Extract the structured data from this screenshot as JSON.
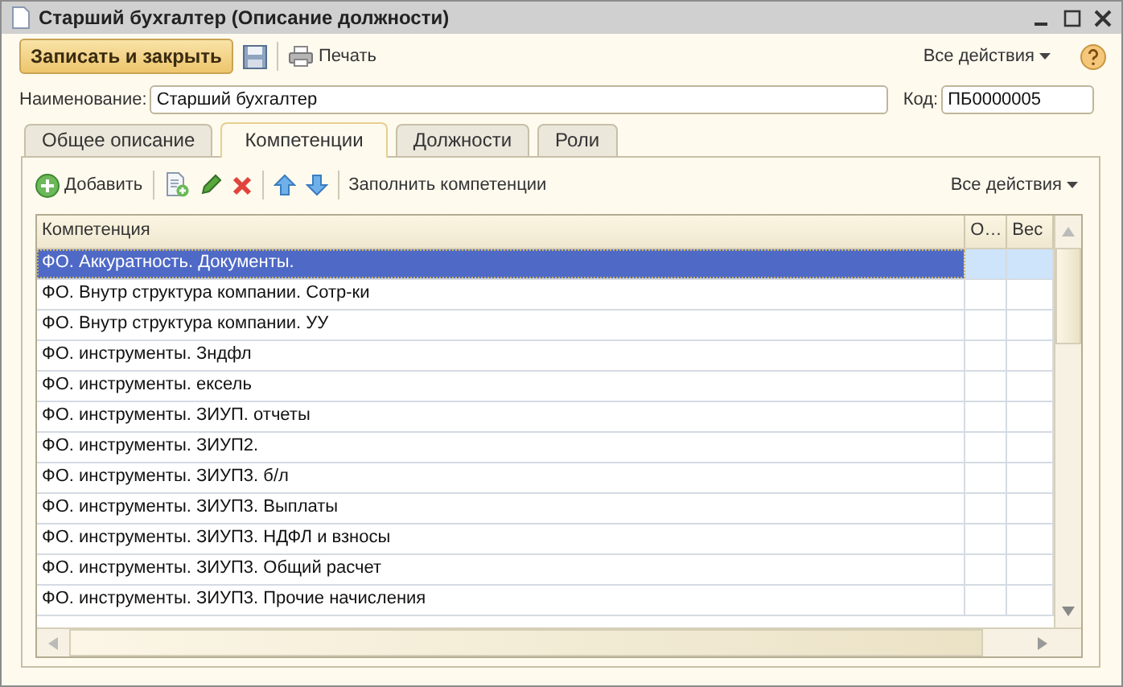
{
  "window": {
    "title": "Старший бухгалтер (Описание должности)"
  },
  "toolbar": {
    "save_close": "Записать и закрыть",
    "print": "Печать",
    "all_actions": "Все действия"
  },
  "fields": [
    {
      "label": "Наименование:",
      "value": "Старший бухгалтер"
    },
    {
      "label": "Код:",
      "value": "ПБ0000005"
    }
  ],
  "tabs": [
    {
      "label": "Общее описание",
      "selected": false
    },
    {
      "label": "Компетенции",
      "selected": true
    },
    {
      "label": "Должности",
      "selected": false
    },
    {
      "label": "Роли",
      "selected": false
    }
  ],
  "panel_toolbar": {
    "add": "Добавить",
    "fill": "Заполнить компетенции",
    "all_actions": "Все действия"
  },
  "table": {
    "columns": [
      "Компетенция",
      "О…",
      "Вес"
    ],
    "rows": [
      {
        "cells": [
          "ФО. Аккуратность. Документы.",
          "",
          ""
        ],
        "selected": true
      },
      {
        "cells": [
          "ФО. Внутр структура компании. Сотр-ки",
          "",
          ""
        ],
        "selected": false
      },
      {
        "cells": [
          "ФО. Внутр структура компании. УУ",
          "",
          ""
        ],
        "selected": false
      },
      {
        "cells": [
          "ФО. инструменты. Зндфл",
          "",
          ""
        ],
        "selected": false
      },
      {
        "cells": [
          "ФО. инструменты. ексель",
          "",
          ""
        ],
        "selected": false
      },
      {
        "cells": [
          "ФО. инструменты. ЗИУП. отчеты",
          "",
          ""
        ],
        "selected": false
      },
      {
        "cells": [
          "ФО. инструменты. ЗИУП2.",
          "",
          ""
        ],
        "selected": false
      },
      {
        "cells": [
          "ФО. инструменты. ЗИУП3. б/л",
          "",
          ""
        ],
        "selected": false
      },
      {
        "cells": [
          "ФО. инструменты. ЗИУП3. Выплаты",
          "",
          ""
        ],
        "selected": false
      },
      {
        "cells": [
          "ФО. инструменты. ЗИУП3. НДФЛ и взносы",
          "",
          ""
        ],
        "selected": false
      },
      {
        "cells": [
          "ФО. инструменты. ЗИУП3. Общий расчет",
          "",
          ""
        ],
        "selected": false
      },
      {
        "cells": [
          "ФО. инструменты. ЗИУП3. Прочие начисления",
          "",
          ""
        ],
        "selected": false
      }
    ]
  }
}
